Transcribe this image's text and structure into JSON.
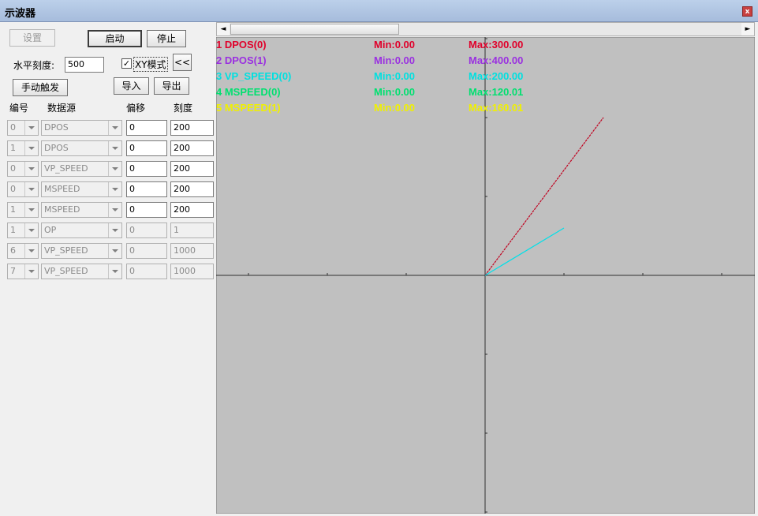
{
  "window": {
    "title": "示波器",
    "close_symbol": "x"
  },
  "controls": {
    "settings_label": "设置",
    "start_label": "启动",
    "stop_label": "停止",
    "horizontal_scale_label": "水平刻度:",
    "horizontal_scale_value": "500",
    "xy_mode_label": "XY模式",
    "xy_mode_checked": true,
    "xy_mode_check_glyph": "✓",
    "collapse_label": "<<",
    "manual_trigger_label": "手动触发",
    "import_label": "导入",
    "export_label": "导出"
  },
  "channel_table": {
    "headers": {
      "num": "编号",
      "source": "数据源",
      "offset": "偏移",
      "scale": "刻度"
    },
    "rows": [
      {
        "num": "0",
        "source": "DPOS",
        "offset": "0",
        "scale": "200",
        "enabled": true
      },
      {
        "num": "1",
        "source": "DPOS",
        "offset": "0",
        "scale": "200",
        "enabled": true
      },
      {
        "num": "0",
        "source": "VP_SPEED",
        "offset": "0",
        "scale": "200",
        "enabled": true
      },
      {
        "num": "0",
        "source": "MSPEED",
        "offset": "0",
        "scale": "200",
        "enabled": true
      },
      {
        "num": "1",
        "source": "MSPEED",
        "offset": "0",
        "scale": "200",
        "enabled": true
      },
      {
        "num": "1",
        "source": "OP",
        "offset": "0",
        "scale": "1",
        "enabled": false
      },
      {
        "num": "6",
        "source": "VP_SPEED",
        "offset": "0",
        "scale": "1000",
        "enabled": false
      },
      {
        "num": "7",
        "source": "VP_SPEED",
        "offset": "0",
        "scale": "1000",
        "enabled": false
      }
    ]
  },
  "scrollbar": {
    "left_arrow": "◄",
    "right_arrow": "►",
    "position": 0.33
  },
  "legend": [
    {
      "name": "1 DPOS(0)",
      "min": "Min:0.00",
      "max": "Max:300.00",
      "color": "#e0002a"
    },
    {
      "name": "2 DPOS(1)",
      "min": "Min:0.00",
      "max": "Max:400.00",
      "color": "#9a30e0"
    },
    {
      "name": "3 VP_SPEED(0)",
      "min": "Min:0.00",
      "max": "Max:200.00",
      "color": "#00e0e0"
    },
    {
      "name": "4 MSPEED(0)",
      "min": "Min:0.00",
      "max": "Max:120.01",
      "color": "#00e070"
    },
    {
      "name": "5 MSPEED(1)",
      "min": "Min:0.00",
      "max": "Max:160.01",
      "color": "#f0f000"
    }
  ],
  "chart_data": {
    "type": "line",
    "mode": "XY",
    "grid": false,
    "background": "#c0c0c0",
    "x_divisions": [
      -3,
      3
    ],
    "y_divisions": [
      -3,
      3
    ],
    "series": [
      {
        "name": "1 DPOS(0)",
        "color": "#c0001e",
        "style": "dashed",
        "x": [
          0,
          1.5
        ],
        "y": [
          0,
          2.0
        ]
      },
      {
        "name": "3 VP_SPEED(0)",
        "color": "#00e0e8",
        "style": "solid",
        "x": [
          0,
          1.0
        ],
        "y": [
          0,
          0.6
        ]
      }
    ]
  }
}
